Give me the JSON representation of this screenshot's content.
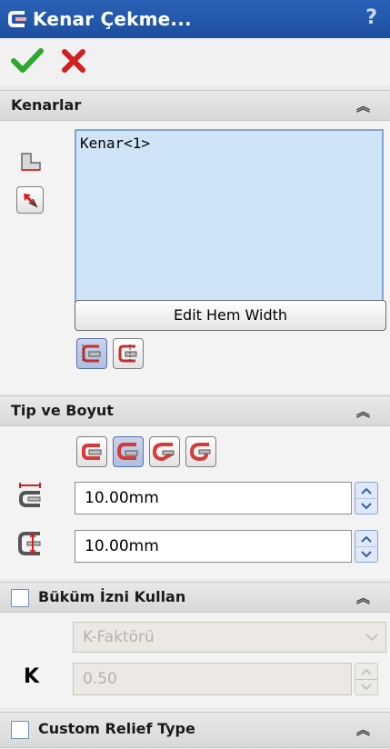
{
  "window": {
    "title": "Kenar Çekme...",
    "help": "?"
  },
  "toolbar": {
    "ok_icon": "check-icon",
    "cancel_icon": "x-icon",
    "ok_color": "#2da82d",
    "cancel_color": "#d21f1f"
  },
  "sections": {
    "kenarlar": {
      "title": "Kenarlar",
      "list_items": [
        "Kenar<1>"
      ],
      "edit_button": "Edit Hem Width"
    },
    "tip_boyut": {
      "title": "Tip ve Boyut",
      "length_value": "10.00mm",
      "gap_value": "10.00mm"
    },
    "bukum": {
      "title": "Büküm İzni Kullan",
      "checked": false,
      "dropdown_value": "K-Faktörü",
      "k_label": "K",
      "k_value": "0.50"
    },
    "relief": {
      "title": "Custom Relief Type",
      "checked": false
    }
  },
  "collapse_glyph": "︽"
}
